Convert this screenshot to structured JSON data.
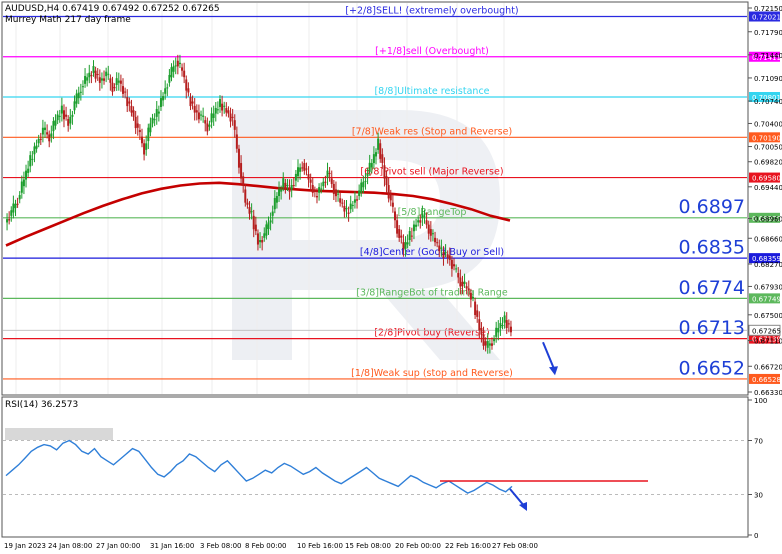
{
  "header": {
    "symbol_line": "AUDUSD,H4  0.67419 0.67492 0.67252 0.67265",
    "indicator_name": "Murrey Math 217 day frame"
  },
  "rsi_panel": {
    "label": "RSI(14) 36.2573"
  },
  "chart_data": {
    "type": "candlestick",
    "symbol": "AUDUSD",
    "timeframe": "H4",
    "ohlc_last": {
      "open": 0.67419,
      "high": 0.67492,
      "low": 0.67252,
      "close": 0.67265
    },
    "ylim": [
      0.6633,
      0.7215
    ],
    "y_ticks": [
      "0.72150",
      "0.71790",
      "0.71440",
      "0.71090",
      "0.70740",
      "0.70400",
      "0.70050",
      "0.69820",
      "0.69440",
      "0.68960",
      "0.68660",
      "0.68270",
      "0.67930",
      "0.67500",
      "0.67110",
      "0.66720",
      "0.66330"
    ],
    "x_ticks": [
      "19 Jan 2023",
      "24 Jan 08:00",
      "27 Jan 00:00",
      "31 Jan 16:00",
      "3 Feb 08:00",
      "8 Feb 00:00",
      "10 Feb 16:00",
      "15 Feb 08:00",
      "20 Feb 00:00",
      "22 Feb 16:00",
      "27 Feb 08:00"
    ],
    "murrey_levels": [
      {
        "label": "[+2/8]SELL! (extremely overbought)",
        "value": 0.72021,
        "value_text": "0.72021",
        "color": "#2a2ae0"
      },
      {
        "label": "[+1/8]sell (Overbought)",
        "value": 0.71411,
        "value_text": "0.71411",
        "color": "#ff00ff"
      },
      {
        "label": "[8/8]Ultimate resistance",
        "value": 0.70801,
        "value_text": "0.70801",
        "color": "#34d5f0"
      },
      {
        "label": "[7/8]Weak res (Stop and Reverse)",
        "value": 0.7019,
        "value_text": "0.70190",
        "color": "#ff5a1e"
      },
      {
        "label": "[6/8]Pivot sell (Major Reverse)",
        "value": 0.6958,
        "value_text": "0.69580",
        "color": "#e8131f"
      },
      {
        "label": "[5/8]RangeTop",
        "value": 0.6897,
        "value_text": "0.68970",
        "color": "#5cb85c"
      },
      {
        "label": "[4/8]Center (Good Buy or Sell)",
        "value": 0.68359,
        "value_text": "0.68359",
        "color": "#1a1adc"
      },
      {
        "label": "[3/8]RangeBot of trading Range",
        "value": 0.67749,
        "value_text": "0.67749",
        "color": "#5cb85c"
      },
      {
        "label": "[2/8]Pivot buy (Reverse)",
        "value": 0.67139,
        "value_text": "0.67139",
        "color": "#e8131f"
      },
      {
        "label": "[1/8]Weak sup (stop and Reverse)",
        "value": 0.66528,
        "value_text": "0.66528",
        "color": "#ff5a1e"
      }
    ],
    "current_price": {
      "value": 0.67265,
      "value_text": "0.67265"
    },
    "callouts": [
      {
        "text": "0.6897",
        "value": 0.6897
      },
      {
        "text": "0.6835",
        "value": 0.6835
      },
      {
        "text": "0.6774",
        "value": 0.6774
      },
      {
        "text": "0.6713",
        "value": 0.6713
      },
      {
        "text": "0.6652",
        "value": 0.6652
      }
    ],
    "price_path": [
      0.689,
      0.6905,
      0.6925,
      0.6955,
      0.6985,
      0.701,
      0.703,
      0.702,
      0.7045,
      0.706,
      0.704,
      0.707,
      0.7095,
      0.711,
      0.712,
      0.7105,
      0.7115,
      0.7095,
      0.7105,
      0.708,
      0.706,
      0.703,
      0.7,
      0.704,
      0.7055,
      0.7085,
      0.711,
      0.7135,
      0.712,
      0.708,
      0.706,
      0.705,
      0.7035,
      0.7055,
      0.707,
      0.706,
      0.7045,
      0.698,
      0.692,
      0.69,
      0.686,
      0.687,
      0.69,
      0.693,
      0.695,
      0.694,
      0.696,
      0.698,
      0.6955,
      0.693,
      0.6945,
      0.6965,
      0.694,
      0.692,
      0.6905,
      0.692,
      0.6935,
      0.696,
      0.698,
      0.701,
      0.696,
      0.692,
      0.688,
      0.685,
      0.687,
      0.689,
      0.69,
      0.688,
      0.686,
      0.6845,
      0.684,
      0.682,
      0.68,
      0.679,
      0.677,
      0.673,
      0.67,
      0.671,
      0.673,
      0.6742,
      0.6727
    ],
    "moving_average": [
      0.6855,
      0.6868,
      0.688,
      0.6892,
      0.6904,
      0.6915,
      0.6925,
      0.6934,
      0.6941,
      0.6946,
      0.6949,
      0.695,
      0.6948,
      0.6945,
      0.6942,
      0.694,
      0.6938,
      0.6937,
      0.6936,
      0.6935,
      0.6933,
      0.693,
      0.6925,
      0.6918,
      0.691,
      0.69,
      0.6893
    ],
    "rsi": {
      "label": "RSI(14)",
      "value": 36.2573,
      "ylim": [
        0,
        100
      ],
      "y_ticks": [
        "100",
        "70",
        "30",
        "0"
      ],
      "values": [
        44,
        48,
        52,
        57,
        62,
        65,
        67,
        66,
        63,
        68,
        70,
        67,
        62,
        60,
        64,
        58,
        55,
        52,
        56,
        60,
        64,
        62,
        56,
        50,
        45,
        43,
        47,
        52,
        55,
        60,
        58,
        54,
        50,
        47,
        52,
        55,
        50,
        45,
        40,
        42,
        45,
        48,
        46,
        50,
        53,
        51,
        48,
        45,
        47,
        50,
        46,
        43,
        40,
        38,
        41,
        44,
        47,
        50,
        46,
        42,
        40,
        38,
        36,
        40,
        44,
        42,
        39,
        37,
        35,
        38,
        40,
        37,
        34,
        31,
        33,
        36,
        39,
        37,
        34,
        32,
        36
      ],
      "trend_line_value": 40,
      "watermark_label": ""
    }
  }
}
